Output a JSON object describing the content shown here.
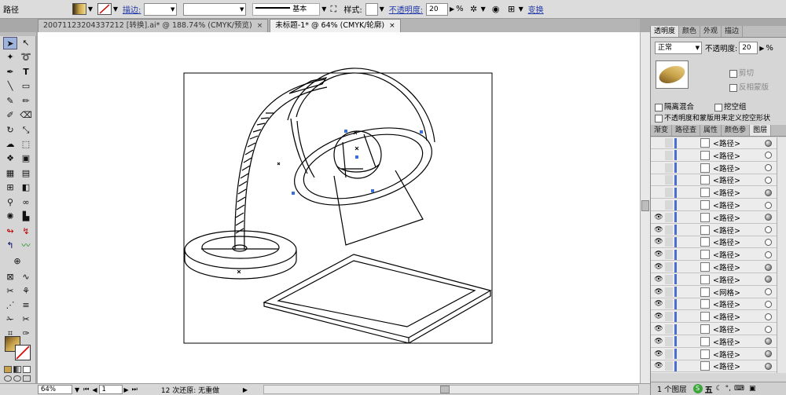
{
  "control_bar": {
    "object_type": "路径",
    "stroke_label": "描边:",
    "stroke_weight": "",
    "profile": "",
    "brush": "基本",
    "style_label": "样式:",
    "opacity_label": "不透明度:",
    "opacity_value": "20",
    "opacity_unit": "%",
    "transform_label": "变换"
  },
  "tabs": [
    {
      "label": "20071123204337212 [转换].ai* @ 188.74% (CMYK/预览)",
      "close": "×"
    },
    {
      "label": "未标题-1* @ 64% (CMYK/轮廓)",
      "close": "×"
    }
  ],
  "status": {
    "zoom": "64%",
    "page": "1",
    "undo_text": "12 次还原: 无重做"
  },
  "transparency_panel": {
    "tabs": [
      "透明度",
      "颜色",
      "外观",
      "描边"
    ],
    "blend_mode": "正常",
    "opacity_label": "不透明度:",
    "opacity_value": "20",
    "opacity_unit": "%",
    "clip_label": "剪切",
    "invert_label": "反相蒙版",
    "isolate_label": "隔离混合",
    "knockout_label": "挖空组",
    "define_knockout_label": "不透明度和蒙版用来定义挖空形状"
  },
  "layers_panel": {
    "tabs": [
      "渐变",
      "路径查",
      "属性",
      "颜色参",
      "图层"
    ],
    "rows": [
      {
        "name": "<路径>",
        "visible": false,
        "filled": true
      },
      {
        "name": "<路径>",
        "visible": false,
        "filled": false
      },
      {
        "name": "<路径>",
        "visible": false,
        "filled": false
      },
      {
        "name": "<路径>",
        "visible": false,
        "filled": false
      },
      {
        "name": "<路径>",
        "visible": false,
        "filled": true
      },
      {
        "name": "<路径>",
        "visible": false,
        "filled": false
      },
      {
        "name": "<路径>",
        "visible": true,
        "filled": true
      },
      {
        "name": "<路径>",
        "visible": true,
        "filled": false
      },
      {
        "name": "<路径>",
        "visible": true,
        "filled": false
      },
      {
        "name": "<路径>",
        "visible": true,
        "filled": false
      },
      {
        "name": "<路径>",
        "visible": true,
        "filled": true
      },
      {
        "name": "<路径>",
        "visible": true,
        "filled": true
      },
      {
        "name": "<网格>",
        "visible": true,
        "filled": false
      },
      {
        "name": "<路径>",
        "visible": true,
        "filled": false
      },
      {
        "name": "<路径>",
        "visible": true,
        "filled": false
      },
      {
        "name": "<路径>",
        "visible": true,
        "filled": false
      },
      {
        "name": "<路径>",
        "visible": true,
        "filled": true
      },
      {
        "name": "<路径>",
        "visible": true,
        "filled": true
      },
      {
        "name": "<路径>",
        "visible": true,
        "filled": true
      }
    ],
    "footer": "1 个图层"
  },
  "ime_bar": {
    "label": "五"
  }
}
